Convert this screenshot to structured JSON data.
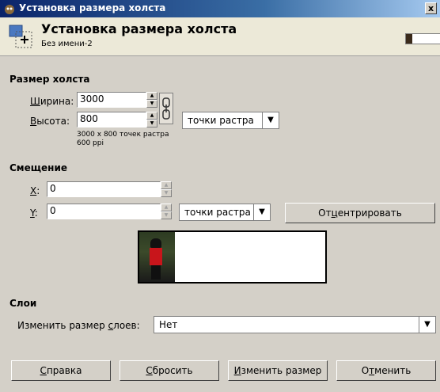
{
  "window": {
    "title": "Установка размера холста",
    "close": "x"
  },
  "header": {
    "title": "Установка размера холста",
    "subtitle": "Без имени-2"
  },
  "canvas_size": {
    "section": "Размер холста",
    "width_label_accel": "Ш",
    "width_label_rest": "ирина:",
    "width_value": "3000",
    "height_label_accel": "В",
    "height_label_rest": "ысота:",
    "height_value": "800",
    "unit": "точки растра",
    "info_size": "3000 x 800 точек растра",
    "info_ppi": "600 ppi"
  },
  "offset": {
    "section": "Смещение",
    "x_label_accel": "X",
    "x_label_rest": ":",
    "x_value": "0",
    "y_label_accel": "Y",
    "y_label_rest": ":",
    "y_value": "0",
    "unit": "точки растра",
    "center_pre": "От",
    "center_accel": "ц",
    "center_post": "ентрировать"
  },
  "layers": {
    "section": "Слои",
    "resize_pre": "Изменить размер ",
    "resize_accel": "с",
    "resize_post": "лоев:",
    "resize_value": "Нет"
  },
  "buttons": {
    "help_accel": "С",
    "help_rest": "правка",
    "reset_accel": "С",
    "reset_rest": "бросить",
    "resize_accel": "И",
    "resize_rest": "зменить размер",
    "cancel_pre": "О",
    "cancel_accel": "т",
    "cancel_post": "менить"
  }
}
